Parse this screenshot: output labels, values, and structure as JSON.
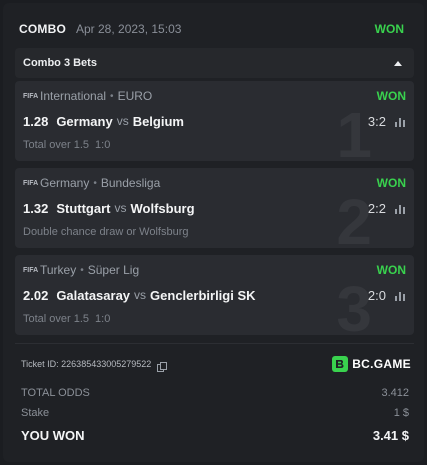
{
  "header": {
    "type": "COMBO",
    "date": "Apr 28, 2023, 15:03",
    "status": "WON",
    "status_color": "#39d24e"
  },
  "combo": {
    "label": "Combo 3 Bets",
    "toggle_icon": "caret-up-icon"
  },
  "bets": [
    {
      "badge": "FIFA",
      "category": "International",
      "league": "EURO",
      "status": "WON",
      "odds": "1.28",
      "home": "Germany",
      "vs": "vs",
      "away": "Belgium",
      "score": "3:2",
      "market": "Total over 1.5",
      "result": "1:0",
      "index": "1"
    },
    {
      "badge": "FIFA",
      "category": "Germany",
      "league": "Bundesliga",
      "status": "WON",
      "odds": "1.32",
      "home": "Stuttgart",
      "vs": "vs",
      "away": "Wolfsburg",
      "score": "2:2",
      "market": "Double chance draw or Wolfsburg",
      "result": "",
      "index": "2"
    },
    {
      "badge": "FIFA",
      "category": "Turkey",
      "league": "Süper Lig",
      "status": "WON",
      "odds": "2.02",
      "home": "Galatasaray",
      "vs": "vs",
      "away": "Genclerbirligi SK",
      "score": "2:0",
      "market": "Total over 1.5",
      "result": "1:0",
      "index": "3"
    }
  ],
  "ticket": {
    "label": "Ticket ID: 226385433005279522",
    "brand": "BC.GAME",
    "brand_color": "#39d24e"
  },
  "summary": {
    "total_odds_label": "TOTAL ODDS",
    "total_odds": "3.412",
    "stake_label": "Stake",
    "stake": "1 $",
    "won_label": "YOU WON",
    "won": "3.41 $"
  }
}
